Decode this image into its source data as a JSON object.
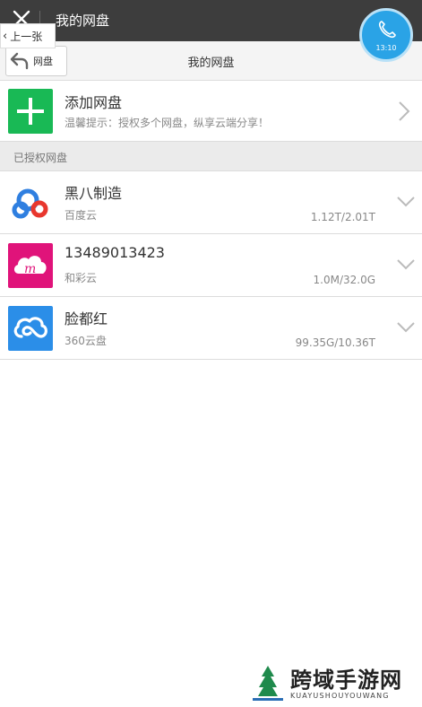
{
  "titlebar": {
    "title": "我的网盘"
  },
  "prev_page": {
    "label": "上一张"
  },
  "navbar": {
    "back_label": "网盘",
    "title": "我的网盘"
  },
  "call_bubble": {
    "time": "13:10"
  },
  "add_disk": {
    "title": "添加网盘",
    "hint": "温馨提示：授权多个网盘，纵享云端分享！"
  },
  "section": {
    "header": "已授权网盘"
  },
  "disks": [
    {
      "name": "黑八制造",
      "provider": "百度云",
      "usage": "1.12T/2.01T",
      "icon": "baidu-cloud-icon"
    },
    {
      "name": "13489013423",
      "provider": "和彩云",
      "usage": "1.0M/32.0G",
      "icon": "hecaiyun-icon"
    },
    {
      "name": "脸都红",
      "provider": "360云盘",
      "usage": "99.35G/10.36T",
      "icon": "360-cloud-icon"
    }
  ],
  "watermark": {
    "cn": "跨域手游网",
    "en": "KUAYUSHOUYOUWANG"
  },
  "colors": {
    "titlebar": "#3d3d3d",
    "add_green": "#19b955",
    "hecaiyun": "#e0137a",
    "cloud360": "#2b8ee8",
    "bubble": "#2aa3e6"
  }
}
